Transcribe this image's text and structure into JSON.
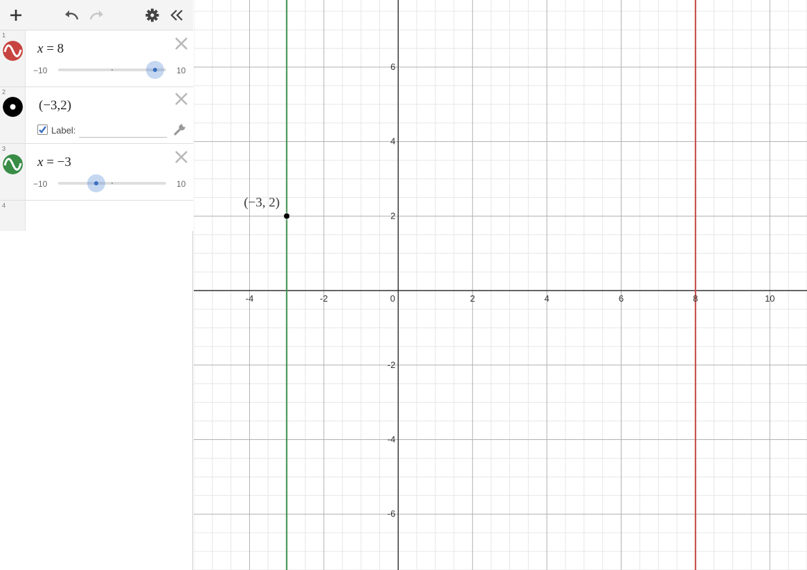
{
  "toolbar": {
    "add_icon": "plus-icon",
    "undo_icon": "undo-icon",
    "redo_icon": "redo-icon",
    "settings_icon": "gear-icon",
    "collapse_icon": "double-chevron-left-icon"
  },
  "expressions": [
    {
      "index": "1",
      "lhs": "x",
      "eq": " = ",
      "rhs": "8",
      "color": "#c74440",
      "slider": {
        "min": "−10",
        "max": "10",
        "value": 8
      }
    },
    {
      "index": "2",
      "text": "(−3,2)",
      "label_text": "Label:",
      "label_checked": true,
      "label_value": "",
      "color": "#000000"
    },
    {
      "index": "3",
      "lhs": "x",
      "eq": " = ",
      "rhs": "−3",
      "color": "#388c46",
      "slider": {
        "min": "−10",
        "max": "10",
        "value": -3
      }
    },
    {
      "index": "4"
    }
  ],
  "graph": {
    "x_range": [
      -5.5,
      11
    ],
    "y_range": [
      -7.5,
      7.8
    ],
    "x_ticks": [
      "-4",
      "-2",
      "0",
      "2",
      "4",
      "6",
      "8",
      "10"
    ],
    "y_ticks": [
      "6",
      "4",
      "2",
      "-2",
      "-4",
      "-6"
    ],
    "vertical_lines": [
      {
        "x": -3,
        "color": "#388c46"
      },
      {
        "x": 8,
        "color": "#c74440"
      }
    ],
    "point": {
      "x": -3,
      "y": 2,
      "label": "(−3, 2)",
      "color": "#000000"
    }
  }
}
